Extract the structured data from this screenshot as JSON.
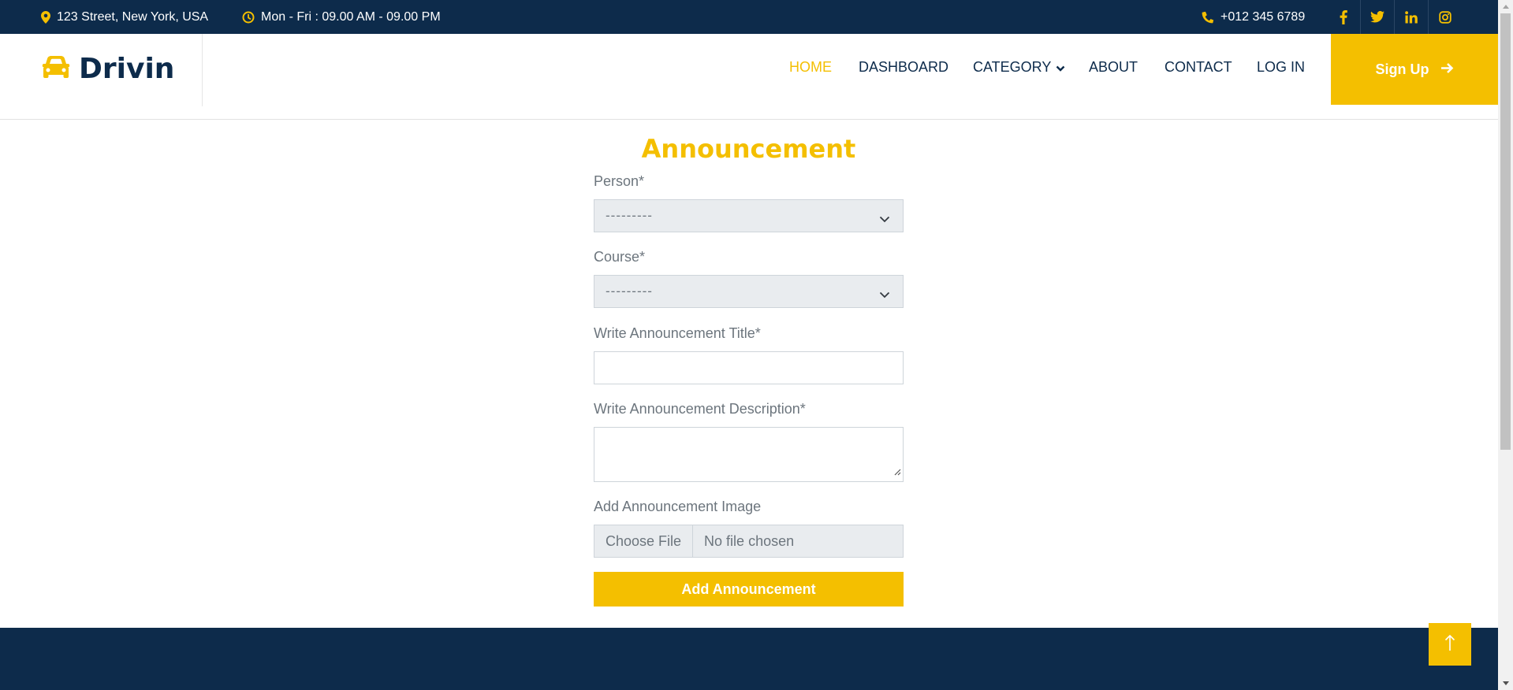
{
  "topbar": {
    "address": "123 Street, New York, USA",
    "hours": "Mon - Fri : 09.00 AM - 09.00 PM",
    "phone": "+012 345 6789",
    "social": [
      "facebook-icon",
      "twitter-icon",
      "linkedin-icon",
      "instagram-icon"
    ]
  },
  "brand": {
    "name": "Drivin",
    "icon": "car-icon"
  },
  "nav": {
    "items": [
      "HOME",
      "DASHBOARD",
      "CATEGORY",
      "ABOUT",
      "CONTACT",
      "LOG IN"
    ],
    "active": "HOME",
    "signup_label": "Sign Up"
  },
  "form": {
    "title": "Announcement",
    "person_label": "Person*",
    "person_value": "---------",
    "course_label": "Course*",
    "course_value": "---------",
    "title_label": "Write Announcement Title*",
    "title_value": "",
    "description_label": "Write Announcement Description*",
    "description_value": "",
    "image_label": "Add Announcement Image",
    "choose_file_label": "Choose File",
    "no_file_label": "No file chosen",
    "submit_label": "Add Announcement"
  },
  "colors": {
    "primary": "#f4bf00",
    "dark": "#0d2b4b",
    "text": "#6c757d"
  }
}
